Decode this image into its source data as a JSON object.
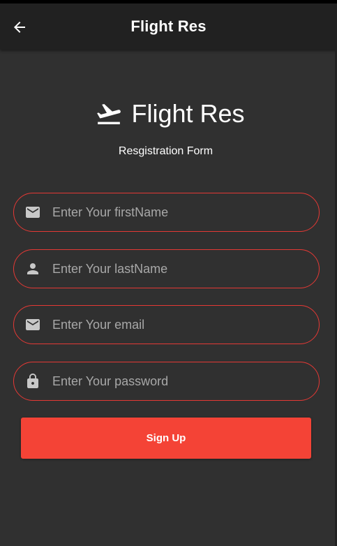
{
  "app_bar": {
    "title": "Flight Res",
    "back_icon": "arrow-back-icon"
  },
  "logo": {
    "icon": "flight-takeoff-icon",
    "text": "Flight Res"
  },
  "form": {
    "subtitle": "Resgistration Form",
    "fields": [
      {
        "icon": "mail-icon",
        "placeholder": "Enter Your firstName",
        "value": ""
      },
      {
        "icon": "person-icon",
        "placeholder": "Enter Your lastName",
        "value": ""
      },
      {
        "icon": "mail-icon",
        "placeholder": "Enter Your email",
        "value": ""
      },
      {
        "icon": "lock-icon",
        "placeholder": "Enter Your password",
        "value": ""
      }
    ],
    "submit_label": "Sign Up"
  },
  "colors": {
    "background": "#303030",
    "app_bar": "#212121",
    "accent": "#f44336",
    "field_border": "#e53935",
    "placeholder": "#a8a8a8"
  }
}
